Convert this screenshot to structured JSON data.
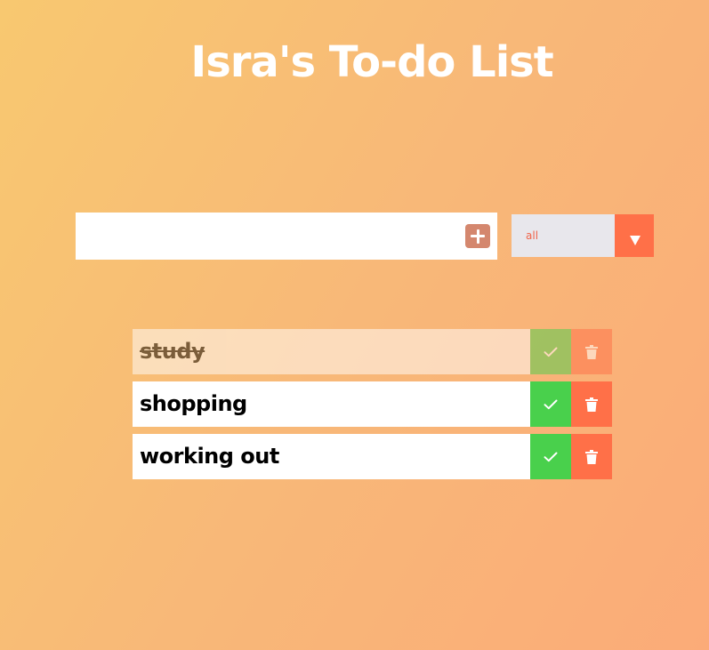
{
  "header": {
    "title": "Isra's To-do List"
  },
  "form": {
    "input_value": "",
    "input_placeholder": "",
    "add_icon": "plus-square-icon",
    "filter": {
      "selected": "all",
      "arrow_icon": "caret-down-icon"
    }
  },
  "todos": [
    {
      "text": "study",
      "completed": true
    },
    {
      "text": "shopping",
      "completed": false
    },
    {
      "text": "working out",
      "completed": false
    }
  ],
  "icons": {
    "complete": "check-icon",
    "delete": "trash-icon"
  },
  "colors": {
    "accent": "#ff7048",
    "complete": "#49d04c",
    "filter_text": "#f0644a",
    "add_button": "#d4876e"
  }
}
